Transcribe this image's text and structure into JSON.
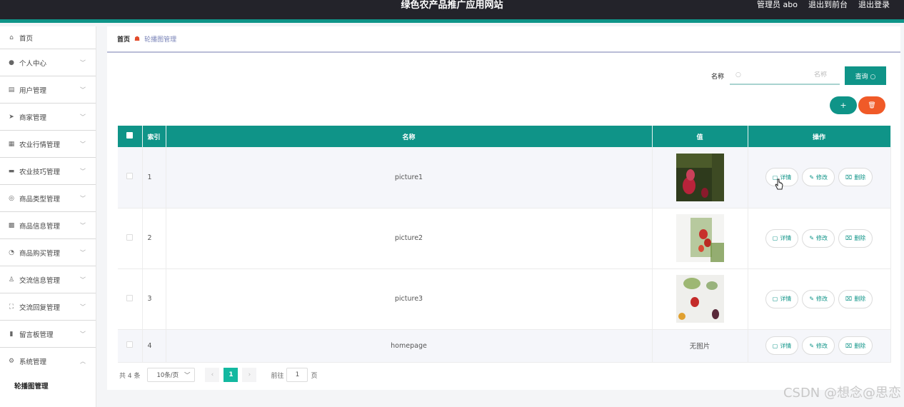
{
  "header": {
    "title": "绿色农产品推广应用网站",
    "admin_label": "管理员 abo",
    "front_label": "退出到前台",
    "logout_label": "退出登录"
  },
  "sidebar": {
    "items": [
      {
        "label": "首页",
        "icon": "home-icon"
      },
      {
        "label": "个人中心",
        "icon": "user-icon"
      },
      {
        "label": "用户管理",
        "icon": "list-icon"
      },
      {
        "label": "商家管理",
        "icon": "send-icon"
      },
      {
        "label": "农业行情管理",
        "icon": "grid-icon"
      },
      {
        "label": "农业技巧管理",
        "icon": "monitor-icon"
      },
      {
        "label": "商品类型管理",
        "icon": "compass-icon"
      },
      {
        "label": "商品信息管理",
        "icon": "chart-icon"
      },
      {
        "label": "商品购买管理",
        "icon": "gauge-icon"
      },
      {
        "label": "交流信息管理",
        "icon": "person-icon"
      },
      {
        "label": "交流回复管理",
        "icon": "frame-icon"
      },
      {
        "label": "留言板管理",
        "icon": "bar-icon"
      },
      {
        "label": "系统管理",
        "icon": "settings-icon"
      }
    ],
    "sub_item": "轮播图管理"
  },
  "breadcrumb": {
    "home": "首页",
    "current": "轮播图管理"
  },
  "search": {
    "label": "名称",
    "placeholder": "名称",
    "button": "查询"
  },
  "toolbar": {
    "add_label": "+",
    "delete_icon": "trash-icon"
  },
  "table": {
    "headers": [
      "",
      "索引",
      "名称",
      "值",
      "操作"
    ],
    "rows": [
      {
        "index": "1",
        "name": "picture1",
        "value": "image"
      },
      {
        "index": "2",
        "name": "picture2",
        "value": "image"
      },
      {
        "index": "3",
        "name": "picture3",
        "value": "image"
      },
      {
        "index": "4",
        "name": "homepage",
        "value": "无图片"
      }
    ],
    "ops": {
      "detail": "详情",
      "edit": "修改",
      "delete": "删除"
    }
  },
  "pager": {
    "total": "共 4 条",
    "page_size": "10条/页",
    "current_page": "1",
    "goto_prefix": "前往",
    "goto_value": "1",
    "goto_suffix": "页"
  },
  "watermark": "CSDN @想念@思恋",
  "colors": {
    "primary": "#0f9488",
    "danger": "#f05a28",
    "header_bg": "#23232a"
  }
}
